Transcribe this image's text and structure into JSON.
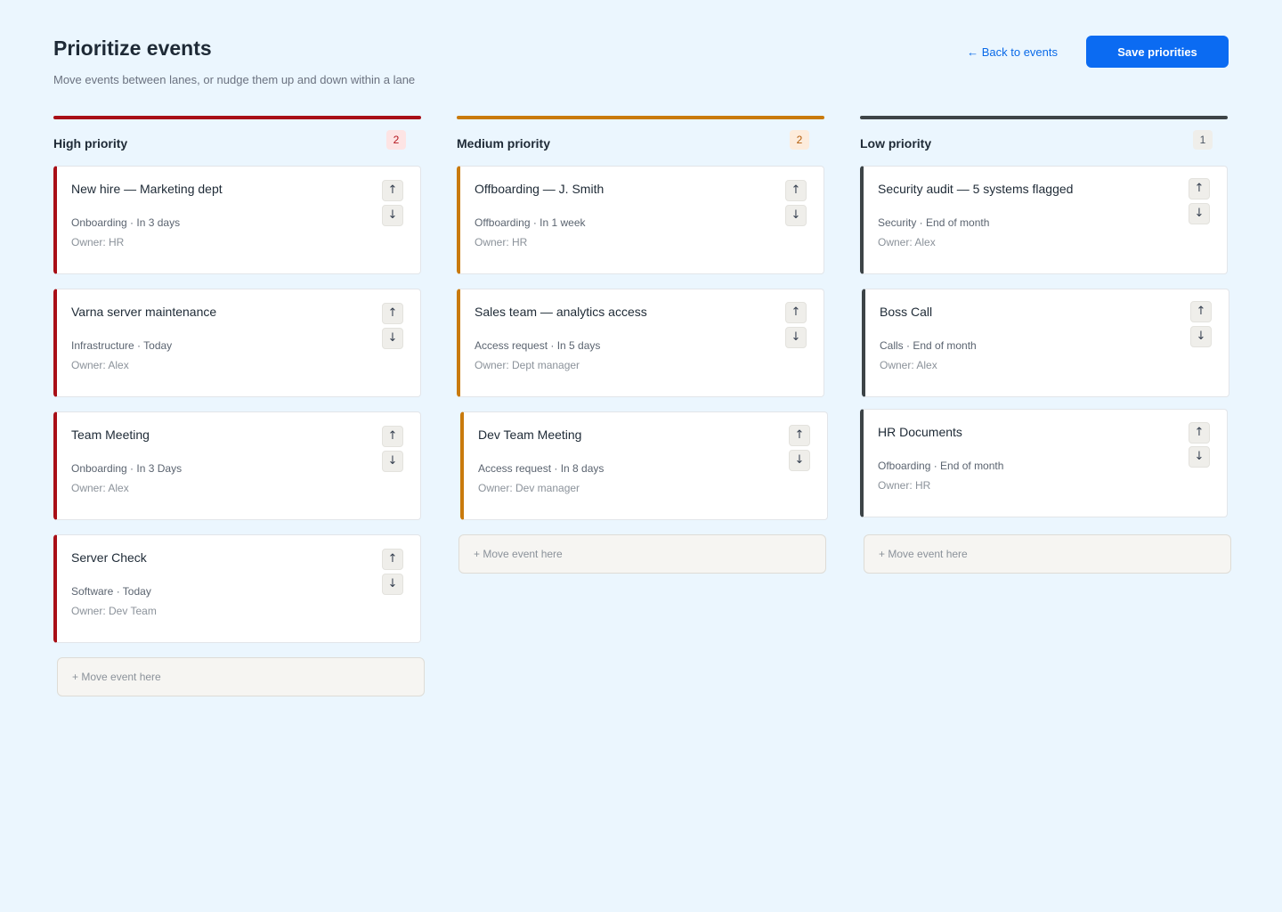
{
  "header": {
    "title": "Prioritize events",
    "subtitle": "Move events between lanes, or nudge them up and down within a lane",
    "back_label": "← Back to events",
    "save_label": "Save priorities"
  },
  "icons": {
    "up": "↑",
    "down": "↓"
  },
  "lanes": [
    {
      "title": "High priority",
      "count": "2",
      "color": "#a80f17",
      "count_bg": "#fde4e4",
      "count_color": "#b3141c",
      "drop_label": "+ Move event here",
      "cards": [
        {
          "title": "New hire — Marketing dept",
          "meta": "Onboarding · In 3 days",
          "owner": "Owner: HR"
        },
        {
          "title": "Varna server maintenance",
          "meta": "Infrastructure · Today",
          "owner": "Owner: Alex"
        },
        {
          "title": "Team Meeting",
          "meta": "Onboarding · In 3 Days",
          "owner": "Owner: Alex"
        },
        {
          "title": "Server Check",
          "meta": "Software · Today",
          "owner": "Owner: Dev Team"
        }
      ]
    },
    {
      "title": "Medium priority",
      "count": "2",
      "color": "#c97a0c",
      "count_bg": "#fdecdc",
      "count_color": "#b35c0a",
      "drop_label": "+ Move event here",
      "cards": [
        {
          "title": "Offboarding — J. Smith",
          "meta": "Offboarding · In 1 week",
          "owner": "Owner: HR"
        },
        {
          "title": "Sales team — analytics access",
          "meta": "Access request · In 5 days",
          "owner": "Owner: Dept manager"
        },
        {
          "title": "Dev Team Meeting",
          "meta": "Access request · In 8 days",
          "owner": "Owner: Dev manager"
        }
      ]
    },
    {
      "title": "Low priority",
      "count": "1",
      "color": "#3d4447",
      "count_bg": "#efeeea",
      "count_color": "#4b5563",
      "drop_label": "+ Move event here",
      "cards": [
        {
          "title": "Security audit — 5 systems flagged",
          "meta": "Security · End of month",
          "owner": "Owner: Alex"
        },
        {
          "title": "Boss Call",
          "meta": "Calls · End of month",
          "owner": "Owner: Alex"
        },
        {
          "title": "HR Documents",
          "meta": "Ofboarding · End of month",
          "owner": "Owner: HR"
        }
      ]
    }
  ]
}
